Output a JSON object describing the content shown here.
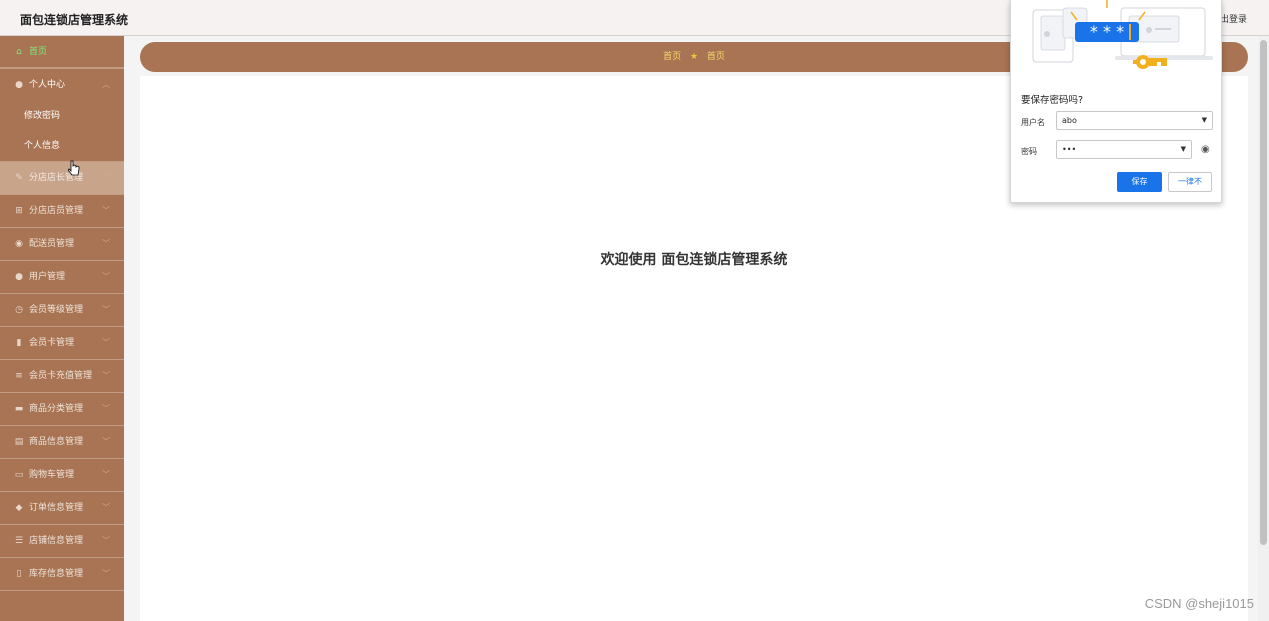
{
  "header": {
    "app_title": "面包连锁店管理系统",
    "logout_label": "退出登录"
  },
  "sidebar": {
    "home": {
      "label": "首页",
      "icon": "home-icon"
    },
    "personal": {
      "label": "个人中心",
      "icon": "user-icon",
      "children": [
        "修改密码",
        "个人信息"
      ]
    },
    "items": [
      {
        "label": "分店店长管理",
        "icon": "manager-icon"
      },
      {
        "label": "分店店员管理",
        "icon": "staff-icon"
      },
      {
        "label": "配送员管理",
        "icon": "delivery-icon"
      },
      {
        "label": "用户管理",
        "icon": "user-icon"
      },
      {
        "label": "会员等级管理",
        "icon": "level-icon"
      },
      {
        "label": "会员卡管理",
        "icon": "chart-icon"
      },
      {
        "label": "会员卡充值管理",
        "icon": "list-icon"
      },
      {
        "label": "商品分类管理",
        "icon": "category-icon"
      },
      {
        "label": "商品信息管理",
        "icon": "goods-icon"
      },
      {
        "label": "购物车管理",
        "icon": "cart-icon"
      },
      {
        "label": "订单信息管理",
        "icon": "order-icon"
      },
      {
        "label": "店铺信息管理",
        "icon": "shop-icon"
      },
      {
        "label": "库存信息管理",
        "icon": "stock-icon"
      }
    ]
  },
  "breadcrumb": {
    "items": [
      "首页",
      "首页"
    ]
  },
  "main": {
    "welcome": "欢迎使用 面包连锁店管理系统"
  },
  "password_popup": {
    "question": "要保存密码吗?",
    "username_label": "用户名",
    "username_value": "abo",
    "password_label": "密码",
    "password_value": "•••",
    "save_label": "保存",
    "never_label": "一律不",
    "illustration_mask": "* * *"
  },
  "watermark": "CSDN @sheji1015",
  "colors": {
    "sidebar": "#a87453",
    "accent_blue": "#1a73e8",
    "home_active": "#7ee87e"
  }
}
